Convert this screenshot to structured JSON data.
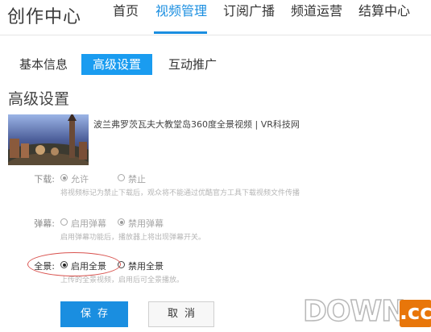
{
  "header": {
    "brand": "创作中心",
    "nav": [
      {
        "label": "首页",
        "active": false
      },
      {
        "label": "视频管理",
        "active": true
      },
      {
        "label": "订阅广播",
        "active": false
      },
      {
        "label": "频道运营",
        "active": false
      },
      {
        "label": "结算中心",
        "active": false
      }
    ]
  },
  "subtabs": [
    {
      "label": "基本信息",
      "active": false
    },
    {
      "label": "高级设置",
      "active": true
    },
    {
      "label": "互动推广",
      "active": false
    }
  ],
  "section_title": "高级设置",
  "video": {
    "title": "波兰弗罗茨瓦夫大教堂岛360度全景视频 | VR科技网"
  },
  "settings": {
    "download": {
      "label": "下载:",
      "options": [
        {
          "label": "允许",
          "checked": true
        },
        {
          "label": "禁止",
          "checked": false
        }
      ],
      "hint": "将视频标记为禁止下载后，观众将不能通过优酷官方工具下载视频文件传播"
    },
    "danmu": {
      "label": "弹幕:",
      "options": [
        {
          "label": "启用弹幕",
          "checked": false
        },
        {
          "label": "禁用弹幕",
          "checked": true
        }
      ],
      "hint": "启用弹幕功能后，播放器上将出现弹幕开关。"
    },
    "panorama": {
      "label": "全景:",
      "options": [
        {
          "label": "启用全景",
          "checked": true
        },
        {
          "label": "禁用全景",
          "checked": false
        }
      ],
      "hint": "上传的全景视频，启用后可全景播放。"
    }
  },
  "buttons": {
    "save": "保存",
    "cancel": "取消"
  },
  "watermark": {
    "text": "DOWN",
    "suffix": ".cc"
  },
  "colors": {
    "accent": "#1a8ee0",
    "annotation": "#d9534f",
    "watermark_orange": "#e8760a"
  }
}
